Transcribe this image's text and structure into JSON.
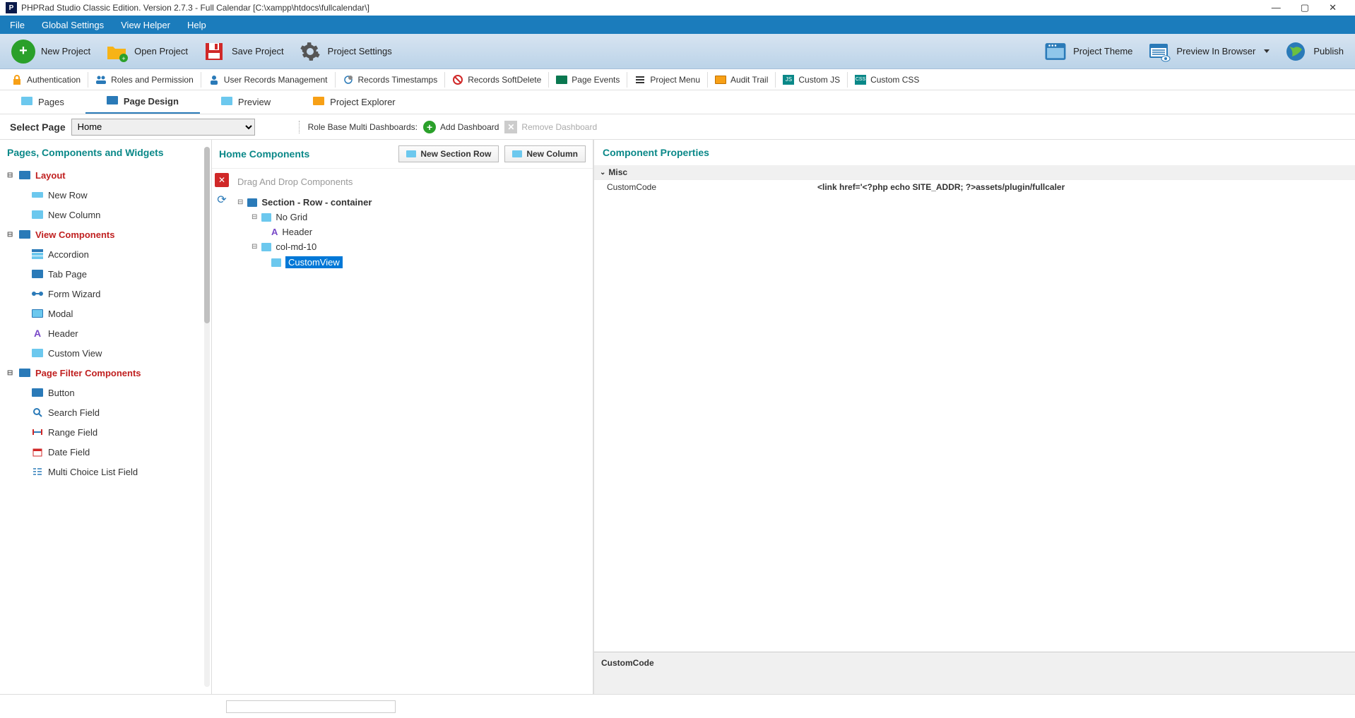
{
  "window": {
    "title": "PHPRad Studio Classic Edition.  Version 2.7.3 - Full Calendar [C:\\xampp\\htdocs\\fullcalendar\\]"
  },
  "menu": {
    "file": "File",
    "global_settings": "Global Settings",
    "view_helper": "View Helper",
    "help": "Help"
  },
  "toolbar1": {
    "new_project": "New Project",
    "open_project": "Open Project",
    "save_project": "Save Project",
    "project_settings": "Project Settings",
    "project_theme": "Project Theme",
    "preview_browser": "Preview In Browser",
    "publish": "Publish"
  },
  "toolbar2": {
    "authentication": "Authentication",
    "roles_permission": "Roles and Permission",
    "user_records": "User Records Management",
    "records_timestamps": "Records Timestamps",
    "records_softdelete": "Records SoftDelete",
    "page_events": "Page Events",
    "project_menu": "Project Menu",
    "audit_trail": "Audit Trail",
    "custom_js": "Custom JS",
    "custom_css": "Custom CSS"
  },
  "tabs": {
    "pages": "Pages",
    "page_design": "Page Design",
    "preview": "Preview",
    "project_explorer": "Project Explorer"
  },
  "selectbar": {
    "label": "Select Page",
    "value": "Home",
    "dash_label": "Role Base Multi Dashboards:",
    "add_dashboard": "Add Dashboard",
    "remove_dashboard": "Remove Dashboard"
  },
  "left_panel": {
    "title": "Pages, Components and Widgets",
    "categories": {
      "layout": {
        "label": "Layout",
        "items": [
          "New Row",
          "New Column"
        ]
      },
      "view_components": {
        "label": "View Components",
        "items": [
          "Accordion",
          "Tab Page",
          "Form Wizard",
          "Modal",
          "Header",
          "Custom View"
        ]
      },
      "page_filter": {
        "label": "Page Filter Components",
        "items": [
          "Button",
          "Search Field",
          "Range Field",
          "Date Field",
          "Multi Choice List Field"
        ]
      }
    }
  },
  "center_panel": {
    "title": "Home Components",
    "new_section_row": "New Section Row",
    "new_column": "New Column",
    "placeholder": "Drag And Drop Components",
    "tree": {
      "section": "Section - Row - container",
      "no_grid": "No Grid",
      "header": "Header",
      "col_md_10": "col-md-10",
      "custom_view": "CustomView"
    }
  },
  "right_panel": {
    "title": "Component Properties",
    "misc": "Misc",
    "custom_code_label": "CustomCode",
    "custom_code_value": "<link href='<?php echo SITE_ADDR; ?>assets/plugin/fullcaler",
    "footer_label": "CustomCode"
  }
}
